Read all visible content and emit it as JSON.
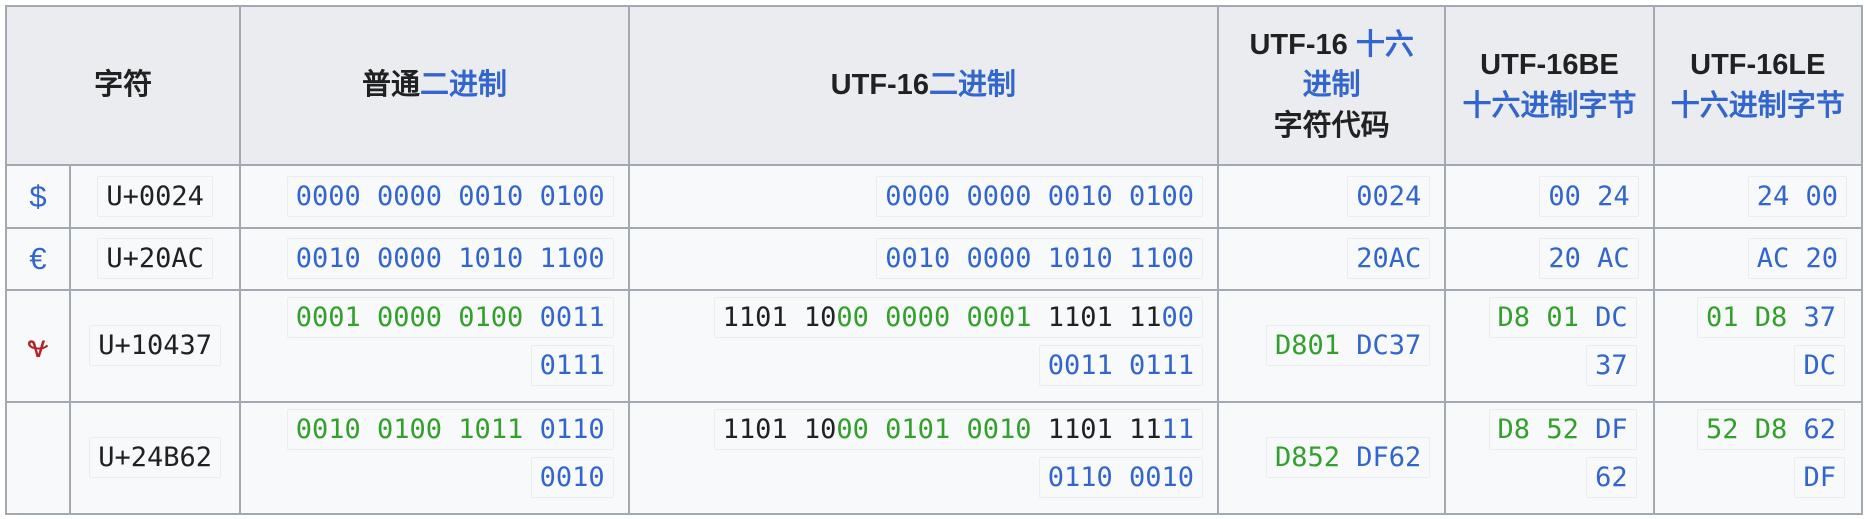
{
  "header": {
    "char": "字符",
    "plain_prefix": "普通",
    "binary_link": "二进制",
    "utf16_prefix": "UTF-16",
    "hex_title_1": "UTF-16 ",
    "hex_title_link1": "十六",
    "hex_title_link2": "进制",
    "hex_title_2": "字符代码",
    "be_title": "UTF-16BE",
    "le_title": "UTF-16LE",
    "hex_bytes_link": "十六进制字节"
  },
  "rows": [
    {
      "glyph": "$",
      "codepoint": "U+0024",
      "plain_binary": "0000 0000 0010 0100",
      "utf16_binary": "0000 0000 0010 0100",
      "hex_code": "0024",
      "be_bytes": "00 24",
      "le_bytes": "24 00"
    },
    {
      "glyph": "€",
      "codepoint": "U+20AC",
      "plain_binary": "0010 0000 1010 1100",
      "utf16_binary": "0010 0000 1010 1100",
      "hex_code": "20AC",
      "be_bytes": "20 AC",
      "le_bytes": "AC 20"
    },
    {
      "glyph": "𐐷",
      "codepoint": "U+10437",
      "plain_binary": {
        "green": "0001 0000 0100 ",
        "blue1": "0011",
        "blue2": "0111"
      },
      "utf16_binary": {
        "k1": "1101 10",
        "g1": "00 0000 0001",
        "k2": " 1101 11",
        "b1": "00",
        "b2": "0011 0111"
      },
      "hex_code": {
        "green": "D801",
        "blue": " DC37"
      },
      "be_bytes": {
        "green": "D8 01",
        "blue1": " DC",
        "blue2": "37"
      },
      "le_bytes": {
        "green": "01 D8",
        "blue1": " 37",
        "blue2": "DC"
      }
    },
    {
      "glyph": "",
      "codepoint": "U+24B62",
      "plain_binary": {
        "green": "0010 0100 1011 ",
        "blue1": "0110",
        "blue2": "0010"
      },
      "utf16_binary": {
        "k1": "1101 10",
        "g1": "00 0101 0010",
        "k2": " 1101 11",
        "b1": "11",
        "b2": "0110 0010"
      },
      "hex_code": {
        "green": "D852",
        "blue": " DF62"
      },
      "be_bytes": {
        "green": "D8 52",
        "blue1": " DF",
        "blue2": "62"
      },
      "le_bytes": {
        "green": "52 D8",
        "blue1": " 62",
        "blue2": "DF"
      }
    }
  ],
  "colors": {
    "link": "#3366cc",
    "green": "#33a02c",
    "red_glyph": "#b32424",
    "header_bg": "#eaecf0",
    "border": "#a2a9b1"
  }
}
